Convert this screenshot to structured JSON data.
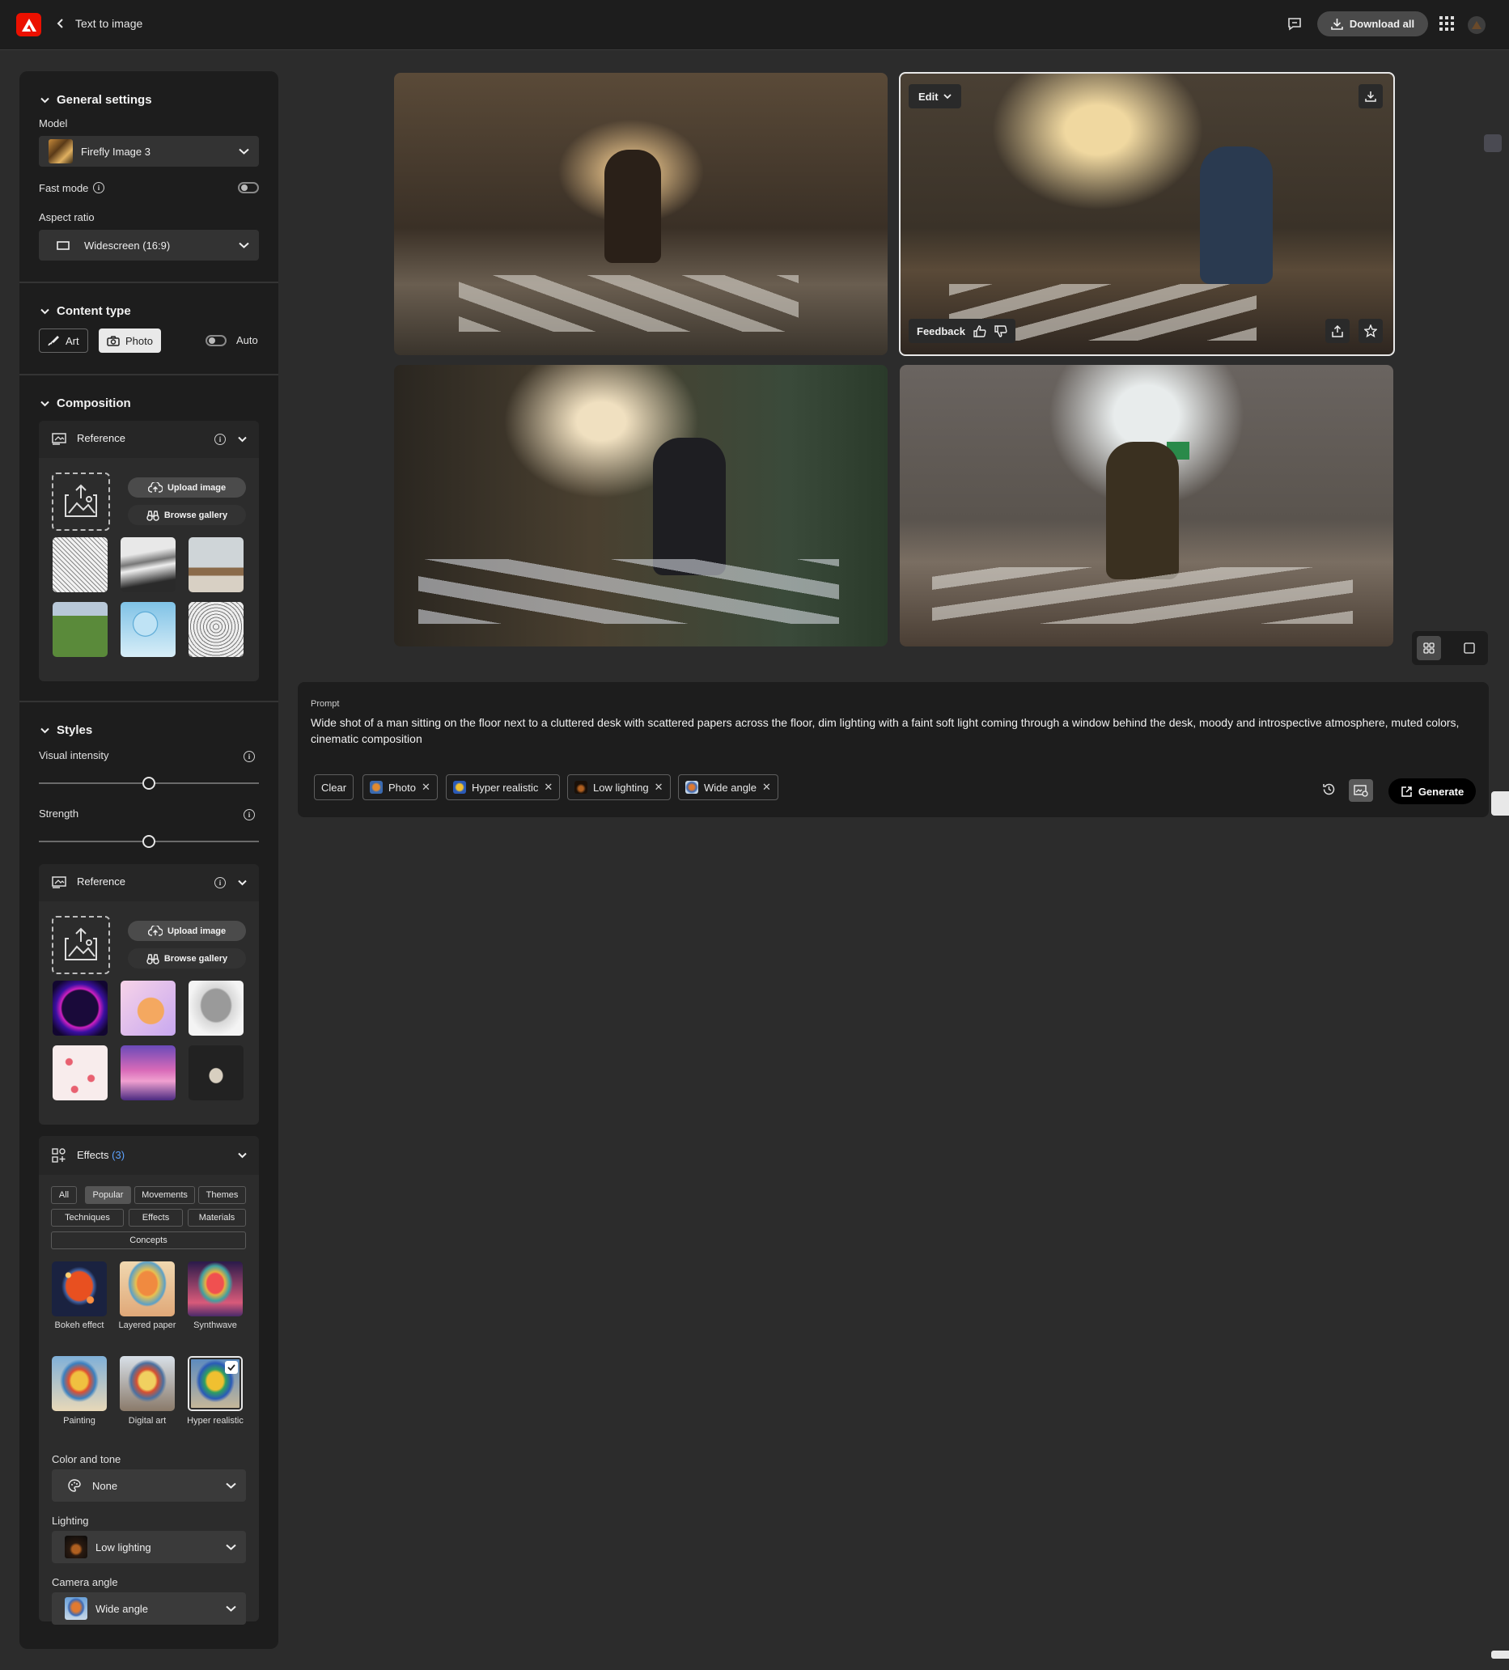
{
  "topbar": {
    "title": "Text to image",
    "download_all": "Download all"
  },
  "panel": {
    "general": {
      "heading": "General settings",
      "model_label": "Model",
      "model_value": "Firefly Image 3",
      "fast_mode_label": "Fast mode",
      "aspect_label": "Aspect ratio",
      "aspect_value": "Widescreen (16:9)"
    },
    "content_type": {
      "heading": "Content type",
      "art": "Art",
      "photo": "Photo",
      "auto": "Auto",
      "selected": "Photo"
    },
    "composition": {
      "heading": "Composition",
      "reference": "Reference",
      "upload": "Upload image",
      "browse": "Browse gallery"
    },
    "styles": {
      "heading": "Styles",
      "visual_intensity": "Visual intensity",
      "strength": "Strength",
      "reference": "Reference",
      "upload": "Upload image",
      "browse": "Browse gallery"
    },
    "effects": {
      "title": "Effects",
      "count": "(3)",
      "tabs": [
        "All",
        "Popular",
        "Movements",
        "Themes",
        "Techniques",
        "Effects",
        "Materials",
        "Concepts"
      ],
      "active_tab": "Popular",
      "items": [
        "Bokeh effect",
        "Layered paper",
        "Synthwave",
        "Painting",
        "Digital art",
        "Hyper realistic"
      ],
      "selected": "Hyper realistic"
    },
    "color_tone": {
      "label": "Color and tone",
      "value": "None"
    },
    "lighting": {
      "label": "Lighting",
      "value": "Low lighting"
    },
    "camera": {
      "label": "Camera angle",
      "value": "Wide angle"
    }
  },
  "gallery": {
    "edit": "Edit",
    "feedback": "Feedback"
  },
  "prompt": {
    "label": "Prompt",
    "text": "Wide shot of a man sitting on the floor next to a cluttered desk with scattered papers across the floor, dim lighting with a faint soft light coming through a window behind the desk, moody and introspective atmosphere, muted colors, cinematic composition",
    "clear": "Clear",
    "chips": [
      "Photo",
      "Hyper realistic",
      "Low lighting",
      "Wide angle"
    ],
    "generate": "Generate"
  },
  "colors": {
    "accent_red": "#eb1000",
    "panel_bg": "#1d1d1d",
    "canvas_bg": "#2c2c2c",
    "link_blue": "#5ea3ff"
  }
}
